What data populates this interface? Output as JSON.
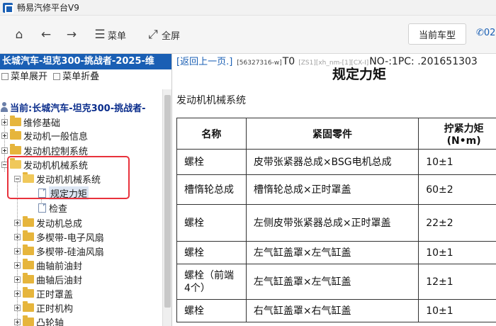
{
  "window": {
    "title": "畅易汽修平台V9"
  },
  "toolbar": {
    "menu_label": "菜单",
    "fullscreen_label": "全屏",
    "vehicle_button": "当前车型",
    "phone_partial": "02"
  },
  "left": {
    "header": "长城汽车-坦克300-挑战者-2025-维",
    "expand_all": "菜单展开",
    "collapse_all": "菜单折叠",
    "current": "当前:长城汽车-坦克300-挑战者-",
    "tree": [
      {
        "label": "维修基础"
      },
      {
        "label": "发动机一般信息"
      },
      {
        "label": "发动机控制系统"
      },
      {
        "label": "发动机机械系统"
      },
      {
        "label": "发动机机械系统"
      },
      {
        "label": "规定力矩"
      },
      {
        "label": "检查"
      },
      {
        "label": "发动机总成"
      },
      {
        "label": "多楔带-电子风扇"
      },
      {
        "label": "多楔带-硅油风扇"
      },
      {
        "label": "曲轴前油封"
      },
      {
        "label": "曲轴后油封"
      },
      {
        "label": "正时罩盖"
      },
      {
        "label": "正时机构"
      },
      {
        "label": "凸轮轴"
      }
    ]
  },
  "right": {
    "back_link": "[返回上一页.]",
    "code1": "[56327316-w]",
    "code2": "T0",
    "code3": "[ZS1][xh_nm-[1][CX-I]",
    "code4": "NO-:1PC: .201651303",
    "title": "规定力矩",
    "section": "发动机机械系统",
    "table": {
      "headers": [
        "名称",
        "紧固零件",
        "拧紧力矩",
        "(N•m)"
      ],
      "rows": [
        [
          "螺栓",
          "皮带张紧器总成×BSG电机总成",
          "10±1"
        ],
        [
          "槽惰轮总成",
          "槽惰轮总成×正时罩盖",
          "60±2"
        ],
        [
          "螺栓",
          "左侧皮带张紧器总成×正时罩盖",
          "22±2"
        ],
        [
          "螺栓",
          "左气缸盖罩×左气缸盖",
          "10±1"
        ],
        [
          "螺栓（前端4个）",
          "左气缸盖罩×左气缸盖",
          "12±1"
        ],
        [
          "螺栓",
          "右气缸盖罩×右气缸盖",
          "10±1"
        ]
      ]
    }
  },
  "colors": {
    "accent": "#1a5fb4",
    "highlight": "#e8323c"
  }
}
